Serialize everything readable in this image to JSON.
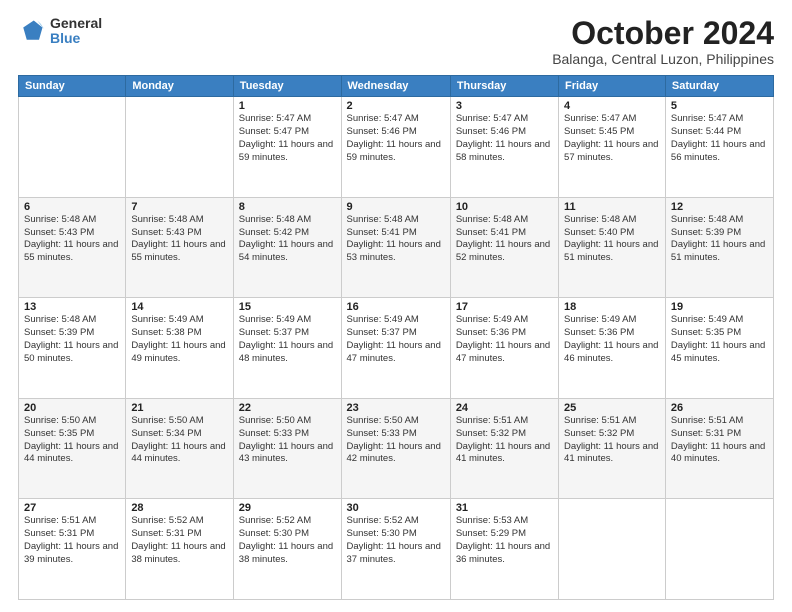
{
  "header": {
    "logo_general": "General",
    "logo_blue": "Blue",
    "month": "October 2024",
    "location": "Balanga, Central Luzon, Philippines"
  },
  "weekdays": [
    "Sunday",
    "Monday",
    "Tuesday",
    "Wednesday",
    "Thursday",
    "Friday",
    "Saturday"
  ],
  "weeks": [
    [
      null,
      null,
      {
        "day": 1,
        "sunrise": "5:47 AM",
        "sunset": "5:47 PM",
        "daylight": "11 hours and 59 minutes."
      },
      {
        "day": 2,
        "sunrise": "5:47 AM",
        "sunset": "5:46 PM",
        "daylight": "11 hours and 59 minutes."
      },
      {
        "day": 3,
        "sunrise": "5:47 AM",
        "sunset": "5:46 PM",
        "daylight": "11 hours and 58 minutes."
      },
      {
        "day": 4,
        "sunrise": "5:47 AM",
        "sunset": "5:45 PM",
        "daylight": "11 hours and 57 minutes."
      },
      {
        "day": 5,
        "sunrise": "5:47 AM",
        "sunset": "5:44 PM",
        "daylight": "11 hours and 56 minutes."
      }
    ],
    [
      {
        "day": 6,
        "sunrise": "5:48 AM",
        "sunset": "5:43 PM",
        "daylight": "11 hours and 55 minutes."
      },
      {
        "day": 7,
        "sunrise": "5:48 AM",
        "sunset": "5:43 PM",
        "daylight": "11 hours and 55 minutes."
      },
      {
        "day": 8,
        "sunrise": "5:48 AM",
        "sunset": "5:42 PM",
        "daylight": "11 hours and 54 minutes."
      },
      {
        "day": 9,
        "sunrise": "5:48 AM",
        "sunset": "5:41 PM",
        "daylight": "11 hours and 53 minutes."
      },
      {
        "day": 10,
        "sunrise": "5:48 AM",
        "sunset": "5:41 PM",
        "daylight": "11 hours and 52 minutes."
      },
      {
        "day": 11,
        "sunrise": "5:48 AM",
        "sunset": "5:40 PM",
        "daylight": "11 hours and 51 minutes."
      },
      {
        "day": 12,
        "sunrise": "5:48 AM",
        "sunset": "5:39 PM",
        "daylight": "11 hours and 51 minutes."
      }
    ],
    [
      {
        "day": 13,
        "sunrise": "5:48 AM",
        "sunset": "5:39 PM",
        "daylight": "11 hours and 50 minutes."
      },
      {
        "day": 14,
        "sunrise": "5:49 AM",
        "sunset": "5:38 PM",
        "daylight": "11 hours and 49 minutes."
      },
      {
        "day": 15,
        "sunrise": "5:49 AM",
        "sunset": "5:37 PM",
        "daylight": "11 hours and 48 minutes."
      },
      {
        "day": 16,
        "sunrise": "5:49 AM",
        "sunset": "5:37 PM",
        "daylight": "11 hours and 47 minutes."
      },
      {
        "day": 17,
        "sunrise": "5:49 AM",
        "sunset": "5:36 PM",
        "daylight": "11 hours and 47 minutes."
      },
      {
        "day": 18,
        "sunrise": "5:49 AM",
        "sunset": "5:36 PM",
        "daylight": "11 hours and 46 minutes."
      },
      {
        "day": 19,
        "sunrise": "5:49 AM",
        "sunset": "5:35 PM",
        "daylight": "11 hours and 45 minutes."
      }
    ],
    [
      {
        "day": 20,
        "sunrise": "5:50 AM",
        "sunset": "5:35 PM",
        "daylight": "11 hours and 44 minutes."
      },
      {
        "day": 21,
        "sunrise": "5:50 AM",
        "sunset": "5:34 PM",
        "daylight": "11 hours and 44 minutes."
      },
      {
        "day": 22,
        "sunrise": "5:50 AM",
        "sunset": "5:33 PM",
        "daylight": "11 hours and 43 minutes."
      },
      {
        "day": 23,
        "sunrise": "5:50 AM",
        "sunset": "5:33 PM",
        "daylight": "11 hours and 42 minutes."
      },
      {
        "day": 24,
        "sunrise": "5:51 AM",
        "sunset": "5:32 PM",
        "daylight": "11 hours and 41 minutes."
      },
      {
        "day": 25,
        "sunrise": "5:51 AM",
        "sunset": "5:32 PM",
        "daylight": "11 hours and 41 minutes."
      },
      {
        "day": 26,
        "sunrise": "5:51 AM",
        "sunset": "5:31 PM",
        "daylight": "11 hours and 40 minutes."
      }
    ],
    [
      {
        "day": 27,
        "sunrise": "5:51 AM",
        "sunset": "5:31 PM",
        "daylight": "11 hours and 39 minutes."
      },
      {
        "day": 28,
        "sunrise": "5:52 AM",
        "sunset": "5:31 PM",
        "daylight": "11 hours and 38 minutes."
      },
      {
        "day": 29,
        "sunrise": "5:52 AM",
        "sunset": "5:30 PM",
        "daylight": "11 hours and 38 minutes."
      },
      {
        "day": 30,
        "sunrise": "5:52 AM",
        "sunset": "5:30 PM",
        "daylight": "11 hours and 37 minutes."
      },
      {
        "day": 31,
        "sunrise": "5:53 AM",
        "sunset": "5:29 PM",
        "daylight": "11 hours and 36 minutes."
      },
      null,
      null
    ]
  ]
}
